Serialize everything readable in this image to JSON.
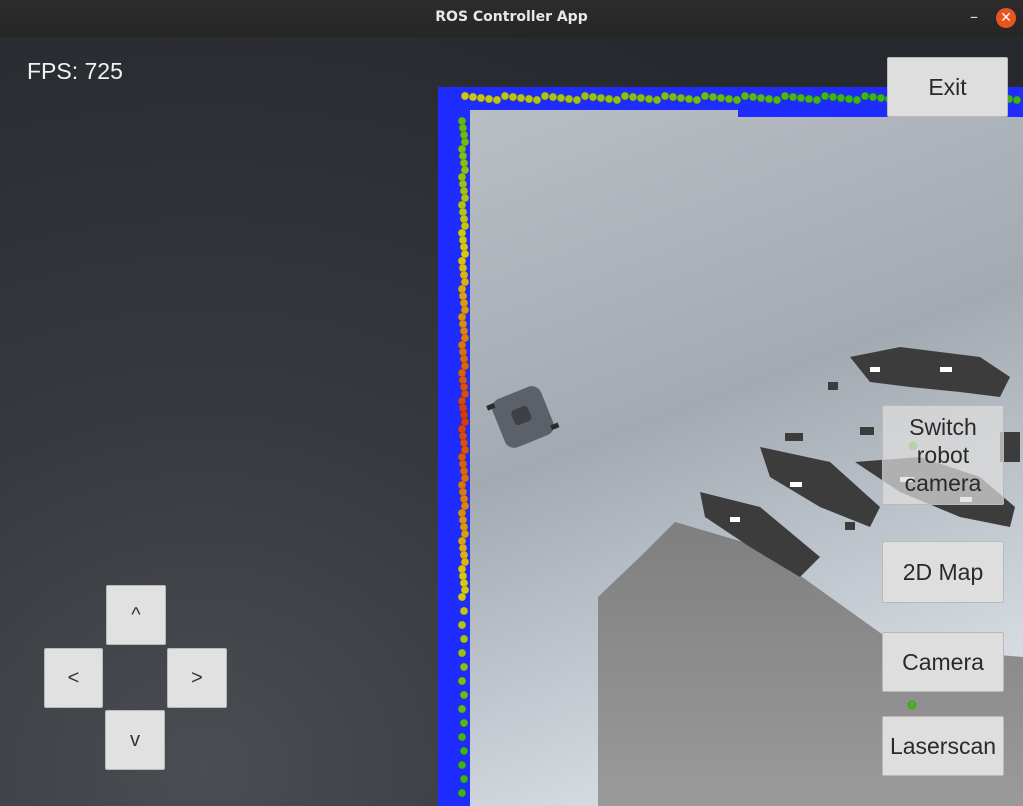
{
  "window": {
    "title": "ROS Controller App",
    "minimize_glyph": "–",
    "close_glyph": "✕"
  },
  "hud": {
    "fps_label": "FPS: 725"
  },
  "buttons": {
    "exit": "Exit",
    "switch_camera": "Switch\nrobot\ncamera",
    "map_2d": "2D Map",
    "camera": "Camera",
    "laserscan": "Laserscan"
  },
  "dpad": {
    "up": "^",
    "left": "<",
    "right": ">",
    "down": "v"
  },
  "colors": {
    "close_button": "#e95420",
    "map_border": "#1f2cff",
    "scan_near": "#d43a10",
    "scan_far": "#35b21c"
  }
}
